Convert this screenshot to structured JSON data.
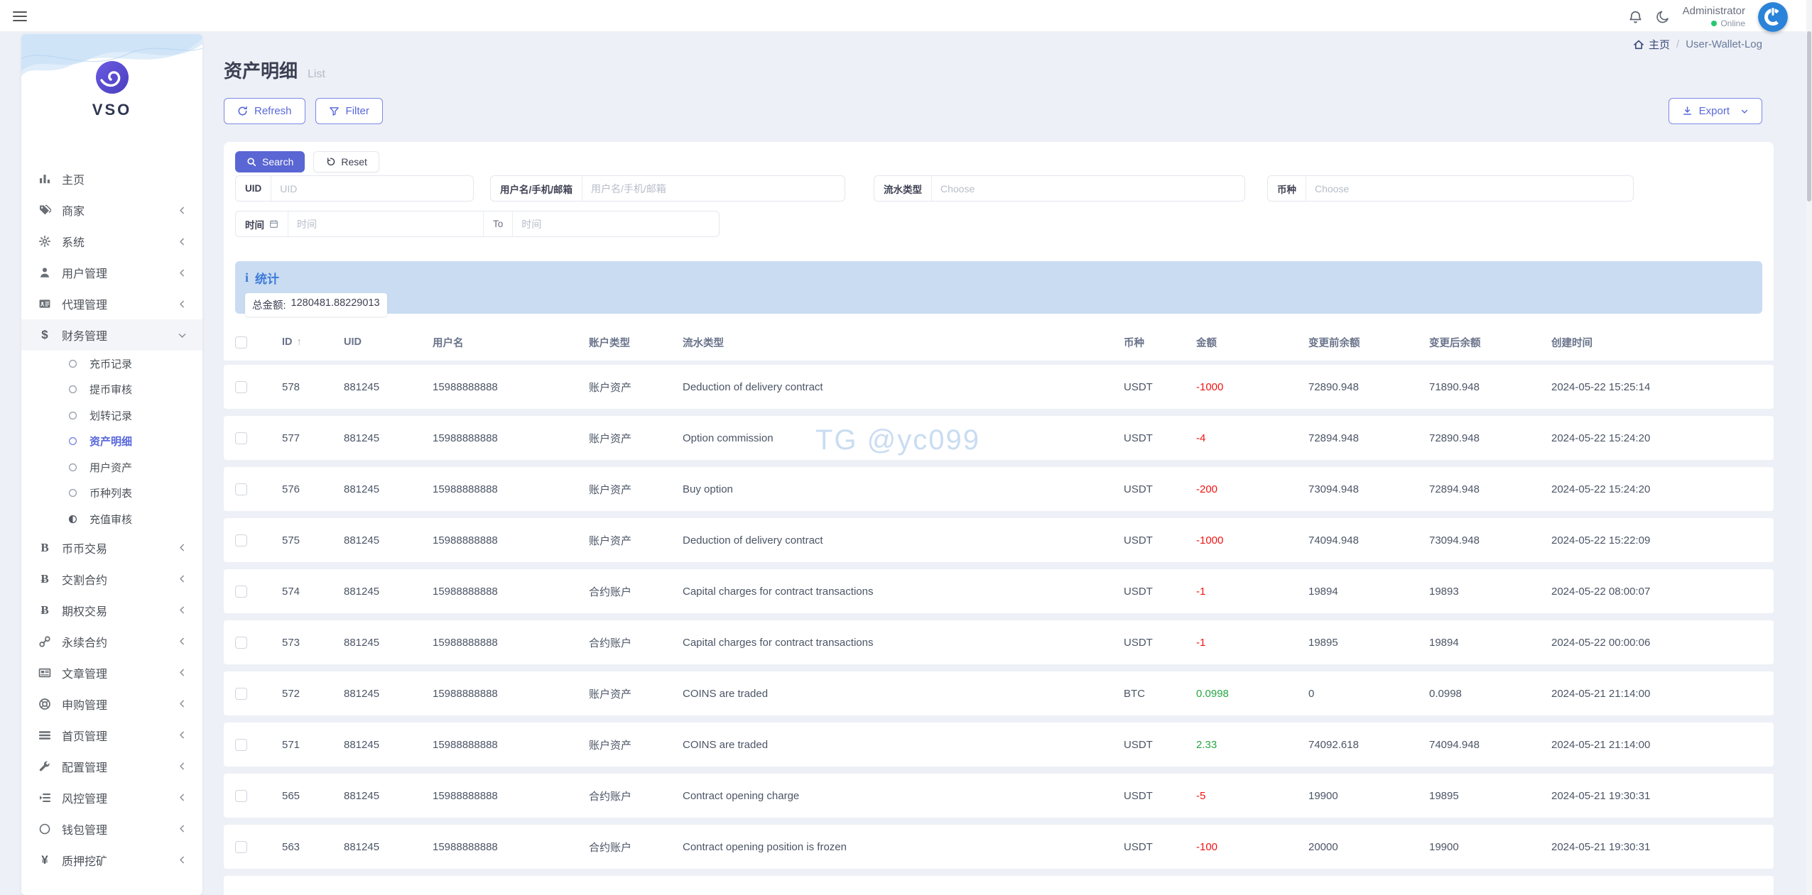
{
  "topbar": {
    "user_name": "Administrator",
    "user_status": "Online",
    "icons": [
      "menu-icon",
      "bell-icon",
      "moon-icon",
      "avatar-logo-icon"
    ]
  },
  "sidebar": {
    "logo_text": "VSO",
    "items": [
      {
        "icon": "chart-bar-icon",
        "label": "主页",
        "chevron": false
      },
      {
        "icon": "tags-icon",
        "label": "商家",
        "chevron": true
      },
      {
        "icon": "gear-icon",
        "label": "系统",
        "chevron": true
      },
      {
        "icon": "user-icon",
        "label": "用户管理",
        "chevron": true
      },
      {
        "icon": "id-card-icon",
        "label": "代理管理",
        "chevron": true
      },
      {
        "icon": "dollar-icon",
        "label": "财务管理",
        "chevron": true,
        "expanded": true,
        "active_section": true,
        "children": [
          {
            "bullet": "circle-bullet-icon",
            "label": "充币记录"
          },
          {
            "bullet": "circle-bullet-icon",
            "label": "提币审核"
          },
          {
            "bullet": "circle-bullet-icon",
            "label": "划转记录"
          },
          {
            "bullet": "circle-bullet-icon",
            "label": "资产明细",
            "active": true
          },
          {
            "bullet": "circle-bullet-icon",
            "label": "用户资产"
          },
          {
            "bullet": "circle-bullet-icon",
            "label": "币种列表"
          },
          {
            "bullet": "half-circle-bullet-icon",
            "label": "充值审核"
          }
        ]
      },
      {
        "icon": "b-serif-icon",
        "label": "币币交易",
        "chevron": true
      },
      {
        "icon": "bitcoin-icon",
        "label": "交割合约",
        "chevron": true
      },
      {
        "icon": "bitcoin-icon",
        "label": "期权交易",
        "chevron": true
      },
      {
        "icon": "link-icon",
        "label": "永续合约",
        "chevron": true
      },
      {
        "icon": "newspaper-icon",
        "label": "文章管理",
        "chevron": true
      },
      {
        "icon": "lifebuoy-icon",
        "label": "申购管理",
        "chevron": true
      },
      {
        "icon": "bars-icon",
        "label": "首页管理",
        "chevron": true
      },
      {
        "icon": "wrench-icon",
        "label": "配置管理",
        "chevron": true
      },
      {
        "icon": "indent-list-icon",
        "label": "风控管理",
        "chevron": true
      },
      {
        "icon": "circle-icon",
        "label": "钱包管理",
        "chevron": true
      },
      {
        "icon": "yen-icon",
        "label": "质押挖矿",
        "chevron": true
      }
    ]
  },
  "page": {
    "title": "资产明细",
    "subtitle": "List",
    "breadcrumb": {
      "home": "主页",
      "separator": "/",
      "current": "User-Wallet-Log"
    },
    "toolbar": {
      "refresh": "Refresh",
      "filter": "Filter",
      "export": "Export"
    }
  },
  "search": {
    "search_label": "Search",
    "reset_label": "Reset",
    "fields": {
      "uid": {
        "label": "UID",
        "placeholder": "UID"
      },
      "user": {
        "label": "用户名/手机/邮箱",
        "placeholder": "用户名/手机/邮箱"
      },
      "flow_type": {
        "label": "流水类型",
        "placeholder": "Choose"
      },
      "coin": {
        "label": "币种",
        "placeholder": "Choose"
      },
      "time": {
        "label": "时间",
        "placeholder_from": "时间",
        "to_label": "To",
        "placeholder_to": "时间"
      }
    }
  },
  "stats": {
    "title": "统计",
    "total_label": "总金额:",
    "total_value": "1280481.88229013"
  },
  "table": {
    "sort_column": "ID",
    "columns": [
      "ID",
      "UID",
      "用户名",
      "账户类型",
      "流水类型",
      "币种",
      "金额",
      "变更前余额",
      "变更后余额",
      "创建时间"
    ],
    "rows": [
      {
        "id": "578",
        "uid": "881245",
        "username": "15988888888",
        "account_type": "账户资产",
        "flow_type": "Deduction of delivery contract",
        "coin": "USDT",
        "amount": "-1000",
        "balance_before": "72890.948",
        "balance_after": "71890.948",
        "created_at": "2024-05-22 15:25:14"
      },
      {
        "id": "577",
        "uid": "881245",
        "username": "15988888888",
        "account_type": "账户资产",
        "flow_type": "Option commission",
        "coin": "USDT",
        "amount": "-4",
        "balance_before": "72894.948",
        "balance_after": "72890.948",
        "created_at": "2024-05-22 15:24:20"
      },
      {
        "id": "576",
        "uid": "881245",
        "username": "15988888888",
        "account_type": "账户资产",
        "flow_type": "Buy option",
        "coin": "USDT",
        "amount": "-200",
        "balance_before": "73094.948",
        "balance_after": "72894.948",
        "created_at": "2024-05-22 15:24:20"
      },
      {
        "id": "575",
        "uid": "881245",
        "username": "15988888888",
        "account_type": "账户资产",
        "flow_type": "Deduction of delivery contract",
        "coin": "USDT",
        "amount": "-1000",
        "balance_before": "74094.948",
        "balance_after": "73094.948",
        "created_at": "2024-05-22 15:22:09"
      },
      {
        "id": "574",
        "uid": "881245",
        "username": "15988888888",
        "account_type": "合约账户",
        "flow_type": "Capital charges for contract transactions",
        "coin": "USDT",
        "amount": "-1",
        "balance_before": "19894",
        "balance_after": "19893",
        "created_at": "2024-05-22 08:00:07"
      },
      {
        "id": "573",
        "uid": "881245",
        "username": "15988888888",
        "account_type": "合约账户",
        "flow_type": "Capital charges for contract transactions",
        "coin": "USDT",
        "amount": "-1",
        "balance_before": "19895",
        "balance_after": "19894",
        "created_at": "2024-05-22 00:00:06"
      },
      {
        "id": "572",
        "uid": "881245",
        "username": "15988888888",
        "account_type": "账户资产",
        "flow_type": "COINS are traded",
        "coin": "BTC",
        "amount": "0.0998",
        "balance_before": "0",
        "balance_after": "0.0998",
        "created_at": "2024-05-21 21:14:00"
      },
      {
        "id": "571",
        "uid": "881245",
        "username": "15988888888",
        "account_type": "账户资产",
        "flow_type": "COINS are traded",
        "coin": "USDT",
        "amount": "2.33",
        "balance_before": "74092.618",
        "balance_after": "74094.948",
        "created_at": "2024-05-21 21:14:00"
      },
      {
        "id": "565",
        "uid": "881245",
        "username": "15988888888",
        "account_type": "合约账户",
        "flow_type": "Contract opening charge",
        "coin": "USDT",
        "amount": "-5",
        "balance_before": "19900",
        "balance_after": "19895",
        "created_at": "2024-05-21 19:30:31"
      },
      {
        "id": "563",
        "uid": "881245",
        "username": "15988888888",
        "account_type": "合约账户",
        "flow_type": "Contract opening position is frozen",
        "coin": "USDT",
        "amount": "-100",
        "balance_before": "20000",
        "balance_after": "19900",
        "created_at": "2024-05-21 19:30:31"
      }
    ]
  },
  "watermark": "TG @yc099",
  "colors": {
    "accent": "#5a66d3",
    "active_menu": "#5867dd",
    "negative": "#f01414",
    "positive": "#27a744",
    "stats_bg": "#c9dcf1",
    "stats_title": "#3e7ad8"
  }
}
